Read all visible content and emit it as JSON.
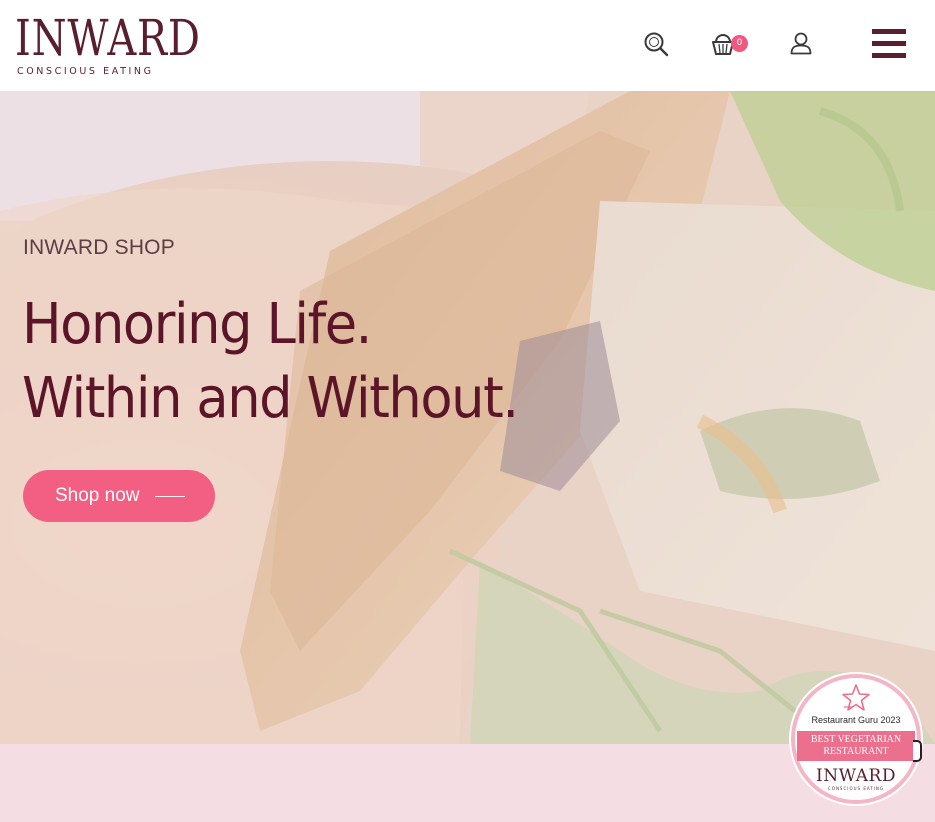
{
  "brand": {
    "name": "INWARD",
    "tagline": "CONSCIOUS EATING",
    "primary_color": "#5a1f2e",
    "accent_color": "#f25f82"
  },
  "header": {
    "search_icon": "search-icon",
    "cart_icon": "basket-icon",
    "cart_count": "0",
    "account_icon": "user-icon",
    "menu_icon": "hamburger-menu-icon"
  },
  "hero": {
    "eyebrow": "INWARD SHOP",
    "headline_line1": "Honoring Life.",
    "headline_line2": "Within and Without.",
    "cta_label": "Shop now",
    "background": "food-photo"
  },
  "award_badge": {
    "title": "Restaurant Guru 2023",
    "ribbon_line1": "BEST VEGETARIAN",
    "ribbon_line2": "RESTAURANT",
    "logo": "INWARD",
    "logo_sub": "CONSCIOUS EATING"
  }
}
